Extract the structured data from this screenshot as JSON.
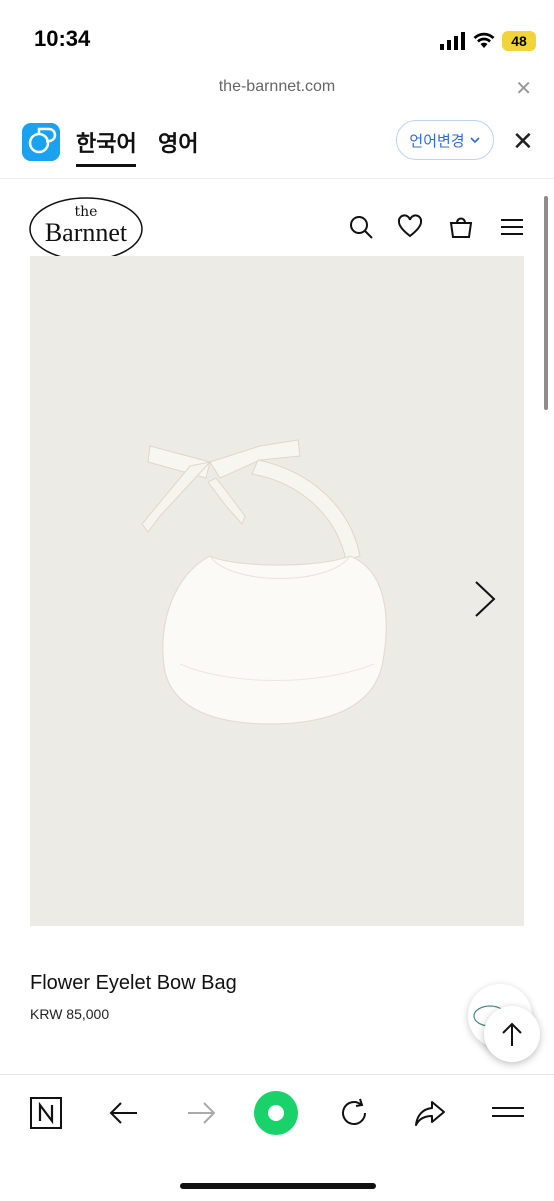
{
  "status_bar": {
    "time": "10:34",
    "battery": "48"
  },
  "browser": {
    "url": "the-barnnet.com",
    "close_icon": "close-icon"
  },
  "translate_bar": {
    "korean_label": "한국어",
    "english_label": "영어",
    "change_label": "언어변경",
    "change_icon": "chevron-down-icon",
    "accent_color": "#2f6be0"
  },
  "site": {
    "logo_top": "the",
    "logo_main": "Barnnet",
    "icons": [
      "search-icon",
      "heart-icon",
      "bag-icon",
      "menu-icon"
    ]
  },
  "product": {
    "name": "Flower Eyelet Bow Bag",
    "price": "KRW 85,000",
    "image": "white eyelet bow bag photo"
  },
  "bottom_toolbar": {
    "icons": [
      "naver-icon",
      "back-arrow-icon",
      "forward-arrow-icon",
      "home-green-icon",
      "refresh-icon",
      "share-icon",
      "menu-icon"
    ]
  }
}
